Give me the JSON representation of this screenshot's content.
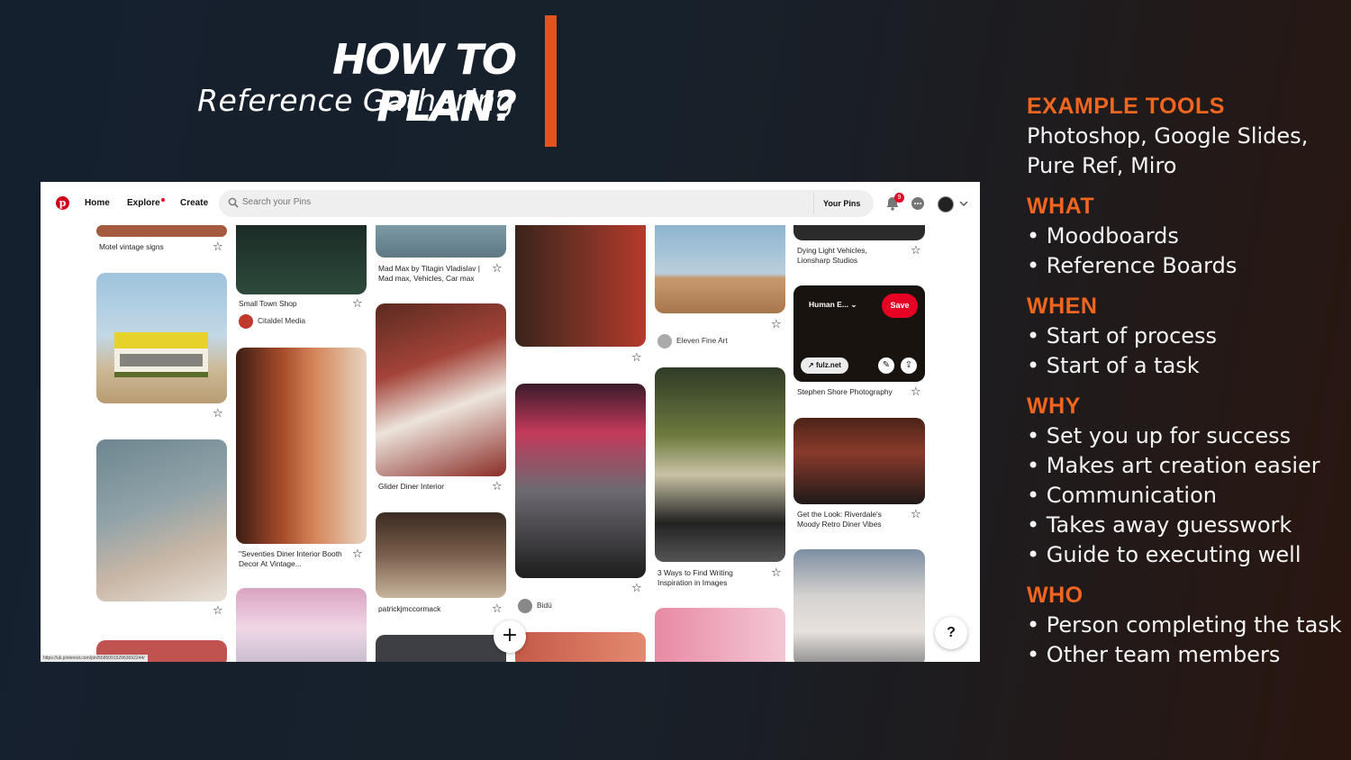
{
  "slide": {
    "title": "HOW TO PLAN?",
    "subtitle": "Reference Gathering",
    "accent_color": "#e2541c",
    "sections": [
      {
        "heading": "EXAMPLE TOOLS",
        "text": "Photoshop, Google Slides, Pure Ref, Miro"
      },
      {
        "heading": "WHAT",
        "items": [
          "Moodboards",
          "Reference Boards"
        ]
      },
      {
        "heading": "WHEN",
        "items": [
          "Start of process",
          "Start of a task"
        ]
      },
      {
        "heading": "WHY",
        "items": [
          "Set you up for success",
          "Makes art creation easier",
          "Communication",
          "Takes away guesswork",
          "Guide to executing well"
        ]
      },
      {
        "heading": "WHO",
        "items": [
          "Person completing the task",
          "Other team members"
        ]
      }
    ]
  },
  "browser": {
    "nav": {
      "home": "Home",
      "explore": "Explore",
      "create": "Create"
    },
    "search": {
      "placeholder": "Search your Pins",
      "scope": "Your Pins"
    },
    "notification_count": "9",
    "brand_color": "#e60023",
    "pins": [
      {
        "title": "Motel vintage signs"
      },
      {
        "title": "Small Town Shop",
        "creator": "Citaldel Media"
      },
      {
        "title": "Mad Max by Titagin Vladislav | Mad max, Vehicles, Car max"
      },
      {
        "title": "Eleven Fine Art"
      },
      {
        "title": "Dying Light Vehicles, Lionsharp Studios"
      },
      {
        "title": "Stephen Shore Photography"
      },
      {
        "title": "Glider Diner Interior"
      },
      {
        "title": "\"Seventies Diner Interior Booth Decor At Vintage..."
      },
      {
        "title": "3 Ways to Find Writing Inspiration in Images"
      },
      {
        "title": "Get the Look: Riverdale's Moody Retro Diner Vibes"
      },
      {
        "title": "patrickjmccormack"
      },
      {
        "title": "Bidü"
      }
    ],
    "hover_overlay": {
      "board": "Human E...",
      "save": "Save",
      "link": "fulz.net"
    },
    "help": "?",
    "status_url": "https://uk.pinterest.com/pin/568509152963692244/"
  }
}
